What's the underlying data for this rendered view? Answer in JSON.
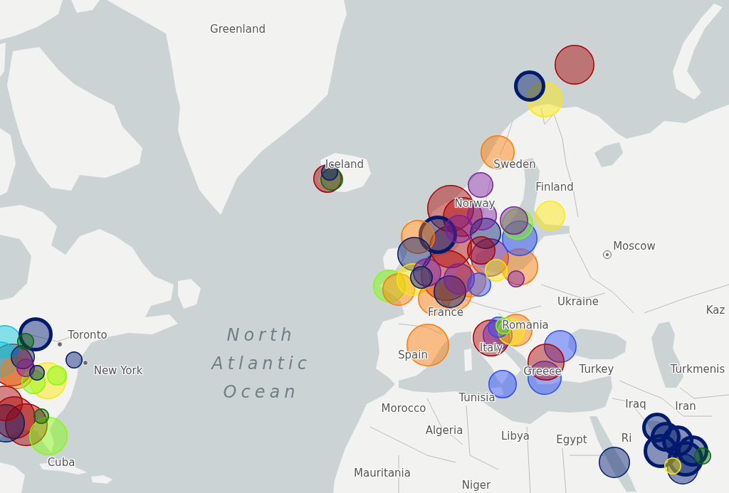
{
  "map_labels": [
    {
      "text": "Greenland",
      "kind": "country"
    },
    {
      "text": "Iceland",
      "kind": "country"
    },
    {
      "text": "Sweden",
      "kind": "country"
    },
    {
      "text": "Finland",
      "kind": "country"
    },
    {
      "text": "Norway",
      "kind": "country"
    },
    {
      "text": "Moscow",
      "kind": "capital"
    },
    {
      "text": "France",
      "kind": "country"
    },
    {
      "text": "Ukraine",
      "kind": "country"
    },
    {
      "text": "Kaz",
      "kind": "country"
    },
    {
      "text": "Toronto",
      "kind": "city"
    },
    {
      "text": "Romania",
      "kind": "country"
    },
    {
      "text": "New York",
      "kind": "city"
    },
    {
      "text": "North Atlantic Ocean",
      "kind": "ocean"
    },
    {
      "text": "Spain",
      "kind": "country"
    },
    {
      "text": "Italy",
      "kind": "country"
    },
    {
      "text": "Greece",
      "kind": "country"
    },
    {
      "text": "Turkey",
      "kind": "country"
    },
    {
      "text": "Turkmenis",
      "kind": "country"
    },
    {
      "text": "Morocco",
      "kind": "country"
    },
    {
      "text": "Tunisia",
      "kind": "country"
    },
    {
      "text": "Iraq",
      "kind": "country"
    },
    {
      "text": "Iran",
      "kind": "country"
    },
    {
      "text": "Algeria",
      "kind": "country"
    },
    {
      "text": "Libya",
      "kind": "country"
    },
    {
      "text": "Egypt",
      "kind": "country"
    },
    {
      "text": "Ri",
      "kind": "country"
    },
    {
      "text": "Cuba",
      "kind": "country"
    },
    {
      "text": "Mauritania",
      "kind": "country"
    },
    {
      "text": "Niger",
      "kind": "country"
    }
  ],
  "markers": [
    {
      "kind": "disc",
      "color": "#aa0000"
    },
    {
      "kind": "disc",
      "color": "#ffe800"
    },
    {
      "kind": "ring",
      "color": "#001a6e"
    },
    {
      "kind": "disc",
      "color": "#ff7a00"
    },
    {
      "kind": "disc",
      "color": "#7a1fa2"
    },
    {
      "kind": "disc",
      "color": "#aa0000"
    },
    {
      "kind": "disc",
      "color": "#0a6b0a"
    },
    {
      "kind": "disc",
      "color": "#001a6e"
    },
    {
      "kind": "disc",
      "color": "#ffe800"
    },
    {
      "kind": "disc",
      "color": "#aa0000"
    },
    {
      "kind": "disc",
      "color": "#aa0000"
    },
    {
      "kind": "disc",
      "color": "#aa0000"
    },
    {
      "kind": "disc",
      "color": "#aa0000"
    },
    {
      "kind": "disc",
      "color": "#7a1fa2"
    },
    {
      "kind": "ring",
      "color": "#001a6e"
    },
    {
      "kind": "disc",
      "color": "#ff7a00"
    },
    {
      "kind": "disc",
      "color": "#2a4bff"
    },
    {
      "kind": "disc",
      "color": "#ff7a00"
    },
    {
      "kind": "disc",
      "color": "#001a6e"
    },
    {
      "kind": "disc",
      "color": "#7fff00"
    },
    {
      "kind": "disc",
      "color": "#ff7a00"
    },
    {
      "kind": "disc",
      "color": "#ffe800"
    },
    {
      "kind": "disc",
      "color": "#ff7a00"
    },
    {
      "kind": "disc",
      "color": "#ff7a00"
    },
    {
      "kind": "disc",
      "color": "#ff7a00"
    },
    {
      "kind": "disc",
      "color": "#001a6e"
    },
    {
      "kind": "disc",
      "color": "#7fff00"
    },
    {
      "kind": "disc",
      "color": "#001a6e"
    },
    {
      "kind": "disc",
      "color": "#7a1fa2"
    },
    {
      "kind": "disc",
      "color": "#7a1fa2"
    },
    {
      "kind": "disc",
      "color": "#aa0000"
    },
    {
      "kind": "disc",
      "color": "#7a1fa2"
    },
    {
      "kind": "disc",
      "color": "#7a1fa2"
    },
    {
      "kind": "disc",
      "color": "#7a1fa2"
    },
    {
      "kind": "disc",
      "color": "#2a4bff"
    },
    {
      "kind": "disc",
      "color": "#ffe800"
    },
    {
      "kind": "disc",
      "color": "#001a6e"
    },
    {
      "kind": "disc",
      "color": "#7a1fa2"
    },
    {
      "kind": "disc",
      "color": "#ff7a00"
    },
    {
      "kind": "disc",
      "color": "#aa0000"
    },
    {
      "kind": "disc",
      "color": "#2a4bff"
    },
    {
      "kind": "disc",
      "color": "#2a4bff"
    },
    {
      "kind": "disc",
      "color": "#aa0000"
    },
    {
      "kind": "disc",
      "color": "#ff7a00"
    },
    {
      "kind": "disc",
      "color": "#7a1fa2"
    },
    {
      "kind": "disc",
      "color": "#ffe800"
    },
    {
      "kind": "disc",
      "color": "#2a4bff"
    },
    {
      "kind": "disc",
      "color": "#2a4bff"
    },
    {
      "kind": "disc",
      "color": "#7fff00"
    },
    {
      "kind": "disc",
      "color": "#001a6e"
    },
    {
      "kind": "ring",
      "color": "#001a6e"
    },
    {
      "kind": "ring",
      "color": "#001a6e"
    },
    {
      "kind": "ring",
      "color": "#001a6e"
    },
    {
      "kind": "ring",
      "color": "#001a6e"
    },
    {
      "kind": "disc",
      "color": "#001a6e"
    },
    {
      "kind": "ring",
      "color": "#001a6e"
    },
    {
      "kind": "ring",
      "color": "#001a6e"
    },
    {
      "kind": "disc",
      "color": "#ffe800"
    },
    {
      "kind": "disc",
      "color": "#0a6b0a"
    },
    {
      "kind": "disc",
      "color": "#aa0000"
    },
    {
      "kind": "disc",
      "color": "#00c8e0"
    },
    {
      "kind": "disc",
      "color": "#00c8e0"
    },
    {
      "kind": "disc",
      "color": "#ffe800"
    },
    {
      "kind": "ring",
      "color": "#001a6e"
    },
    {
      "kind": "disc",
      "color": "#ff7a00"
    },
    {
      "kind": "disc",
      "color": "#001a6e"
    },
    {
      "kind": "disc",
      "color": "#7fff00"
    },
    {
      "kind": "disc",
      "color": "#7a1fa2"
    },
    {
      "kind": "disc",
      "color": "#7fff00"
    },
    {
      "kind": "disc",
      "color": "#001a6e"
    },
    {
      "kind": "disc",
      "color": "#0a6b0a"
    },
    {
      "kind": "disc",
      "color": "#001a6e"
    },
    {
      "kind": "disc",
      "color": "#aa0000"
    },
    {
      "kind": "disc",
      "color": "#aa0000"
    },
    {
      "kind": "disc",
      "color": "#7fff00"
    },
    {
      "kind": "disc",
      "color": "#001a6e"
    },
    {
      "kind": "disc",
      "color": "#aa0000"
    },
    {
      "kind": "disc",
      "color": "#0a6b0a"
    }
  ]
}
